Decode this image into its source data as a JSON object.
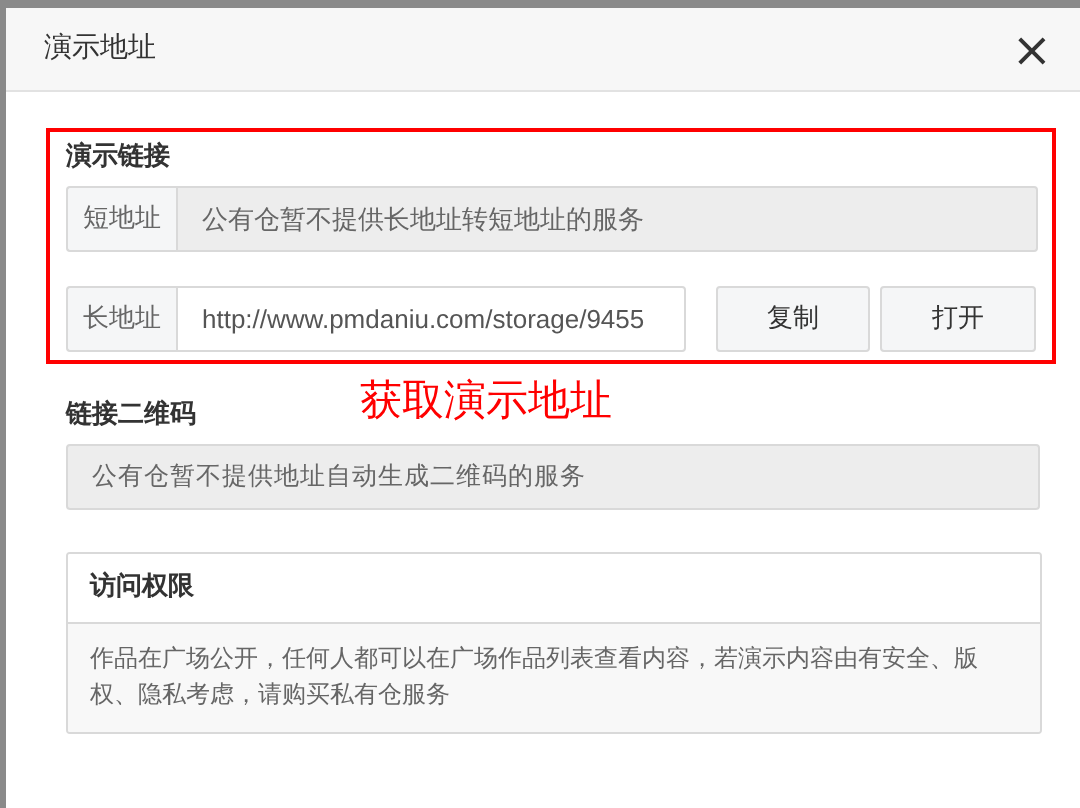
{
  "dialog": {
    "title": "演示地址",
    "close": "×"
  },
  "demo_link": {
    "label": "演示链接",
    "short": {
      "addon": "短地址",
      "value": "公有仓暂不提供长地址转短地址的服务",
      "disabled": true
    },
    "long": {
      "addon": "长地址",
      "value": "http://www.pmdaniu.com/storage/9455",
      "disabled": false
    },
    "buttons": [
      "复制",
      "打开"
    ]
  },
  "annotation": "获取演示地址",
  "qr": {
    "label": "链接二维码",
    "value": "公有仓暂不提供地址自动生成二维码的服务",
    "disabled": true
  },
  "access": {
    "title": "访问权限",
    "body": "作品在广场公开，任何人都可以在广场作品列表查看内容，若演示内容由有安全、版权、隐私考虑，请购买私有仓服务"
  }
}
